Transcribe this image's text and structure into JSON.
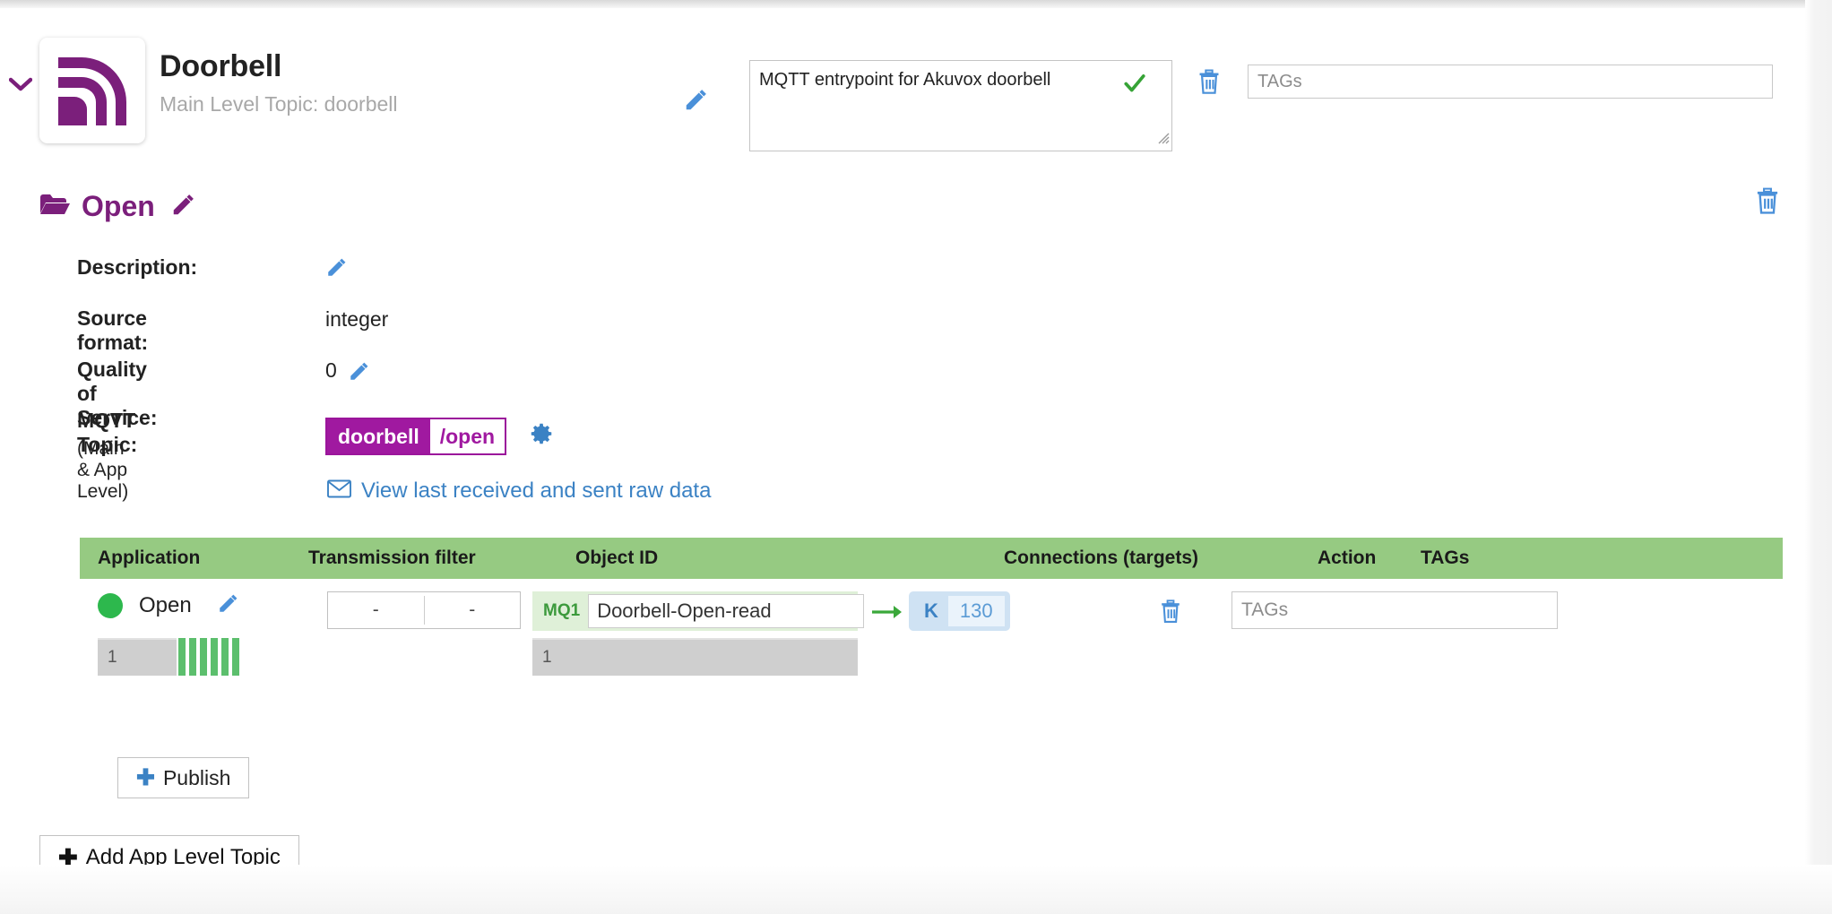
{
  "header": {
    "collapse_icon": "chevron-down-icon",
    "logo_icon": "mqtt-signal-icon",
    "device_title": "Doorbell",
    "main_level_topic": "Main Level Topic: doorbell",
    "edit_icon": "pencil-icon",
    "description_value": "MQTT entrypoint for Akuvox doorbell",
    "description_confirm_icon": "check-icon",
    "delete_icon": "trash-icon",
    "tags_placeholder": "TAGs",
    "tags_value": ""
  },
  "section": {
    "folder_icon": "folder-open-icon",
    "title": "Open",
    "edit_icon": "pencil-icon",
    "delete_icon": "trash-icon",
    "properties": [
      {
        "label": "Description:",
        "value": "",
        "has_pencil": true
      },
      {
        "label": "Source format:",
        "value": "integer",
        "has_pencil": false
      },
      {
        "label": "Quality of Service:",
        "value": "0",
        "has_pencil": true
      }
    ],
    "mqtt_topic": {
      "label": "MQTT Topic:",
      "sublabel": "(Main & App Level)",
      "main_level": "doorbell",
      "app_level": "/open",
      "settings_icon": "gear-icon"
    },
    "raw_data_link": {
      "icon": "envelope-icon",
      "text": "View last received and sent raw data"
    }
  },
  "table": {
    "columns": [
      "Application",
      "Transmission filter",
      "Object ID",
      "Connections (targets)",
      "Action",
      "TAGs"
    ],
    "rows": [
      {
        "status_icon": "status-dot-green",
        "app_name": "Open",
        "app_edit_icon": "pencil-icon",
        "app_count": "1",
        "activity_bars": 6,
        "filter_left": "-",
        "filter_right": "-",
        "object_tag": "MQ1",
        "object_id": "Doorbell-Open-read",
        "object_count": "1",
        "arrow_icon": "arrow-right-icon",
        "connection_prefix": "K",
        "connection_value": "130",
        "delete_icon": "trash-icon",
        "tags_placeholder": "TAGs",
        "tags_value": ""
      }
    ]
  },
  "buttons": {
    "publish": "Publish",
    "publish_icon": "plus-icon",
    "add_topic": "Add App Level Topic",
    "add_topic_icon": "plus-icon"
  },
  "colors": {
    "brand_purple": "#7b1f7b",
    "topic_purple": "#a019a0",
    "table_header_green": "#96ca82",
    "link_blue": "#3b82c4",
    "status_green": "#2db84d"
  }
}
